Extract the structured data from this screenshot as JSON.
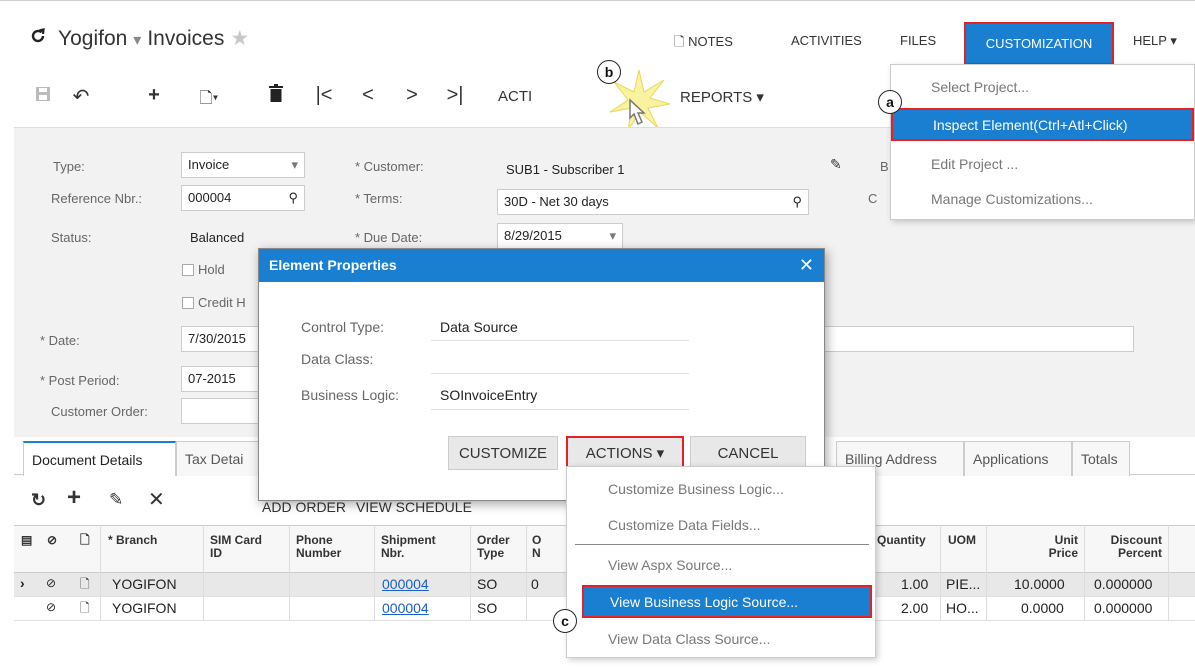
{
  "header": {
    "company": "Yogifon",
    "page": "Invoices",
    "nav": [
      "NOTES",
      "ACTIVITIES",
      "FILES",
      "CUSTOMIZATION",
      "HELP"
    ]
  },
  "toolbar": {
    "actions_label": "ACTI",
    "reports_label": "REPORTS"
  },
  "customization_menu": {
    "items": [
      "Select Project...",
      "Inspect Element(Ctrl+Atl+Click)",
      "Edit Project ...",
      "Manage Customizations..."
    ]
  },
  "form": {
    "type_label": "Type:",
    "type_value": "Invoice",
    "refnbr_label": "Reference Nbr.:",
    "refnbr_value": "000004",
    "status_label": "Status:",
    "status_value": "Balanced",
    "hold_label": "Hold",
    "credit_label": "Credit H",
    "date_label": "* Date:",
    "date_value": "7/30/2015",
    "postperiod_label": "* Post Period:",
    "postperiod_value": "07-2015",
    "custorder_label": "Customer Order:",
    "customer_label": "* Customer:",
    "customer_value": "SUB1 - Subscriber 1",
    "terms_label": "* Terms:",
    "terms_value": "30D - Net 30 days",
    "duedate_label": "* Due Date:",
    "duedate_value": "8/29/2015",
    "b_label": "B",
    "c_label": "C"
  },
  "dialog": {
    "title": "Element Properties",
    "control_type_label": "Control Type:",
    "control_type_value": "Data Source",
    "data_class_label": "Data Class:",
    "business_logic_label": "Business Logic:",
    "business_logic_value": "SOInvoiceEntry",
    "customize": "CUSTOMIZE",
    "actions": "ACTIONS",
    "cancel": "CANCEL"
  },
  "actions_menu": {
    "items": [
      "Customize Business Logic...",
      "Customize Data Fields...",
      "View Aspx Source...",
      "View Business Logic Source...",
      "View Data Class Source..."
    ]
  },
  "tabs": [
    "Document Details",
    "Tax Detai",
    "Billing Address",
    "Applications",
    "Totals"
  ],
  "grid_toolbar": {
    "add_order": "ADD ORDER",
    "view_schedule": "VIEW SCHEDULE"
  },
  "grid": {
    "headers": {
      "branch": "* Branch",
      "sim": "SIM Card ID",
      "phone": "Phone Number",
      "shipment": "Shipment Nbr.",
      "ordertype": "Order Type",
      "o": "O N",
      "quantity": "Quantity",
      "uom": "UOM",
      "unitprice": "Unit Price",
      "discount": "Discount Percent"
    },
    "rows": [
      {
        "branch": "YOGIFON",
        "shipment": "000004",
        "ordertype": "SO",
        "o": "0",
        "quantity": "1.00",
        "uom": "PIE...",
        "unitprice": "10.0000",
        "discount": "0.000000"
      },
      {
        "branch": "YOGIFON",
        "shipment": "000004",
        "ordertype": "SO",
        "o": "",
        "quantity": "2.00",
        "uom": "HO...",
        "unitprice": "0.0000",
        "discount": "0.000000"
      }
    ]
  },
  "callouts": [
    "a",
    "b",
    "c"
  ],
  "colors": {
    "accent": "#1a7fd1",
    "highlight_border": "#e32126"
  }
}
